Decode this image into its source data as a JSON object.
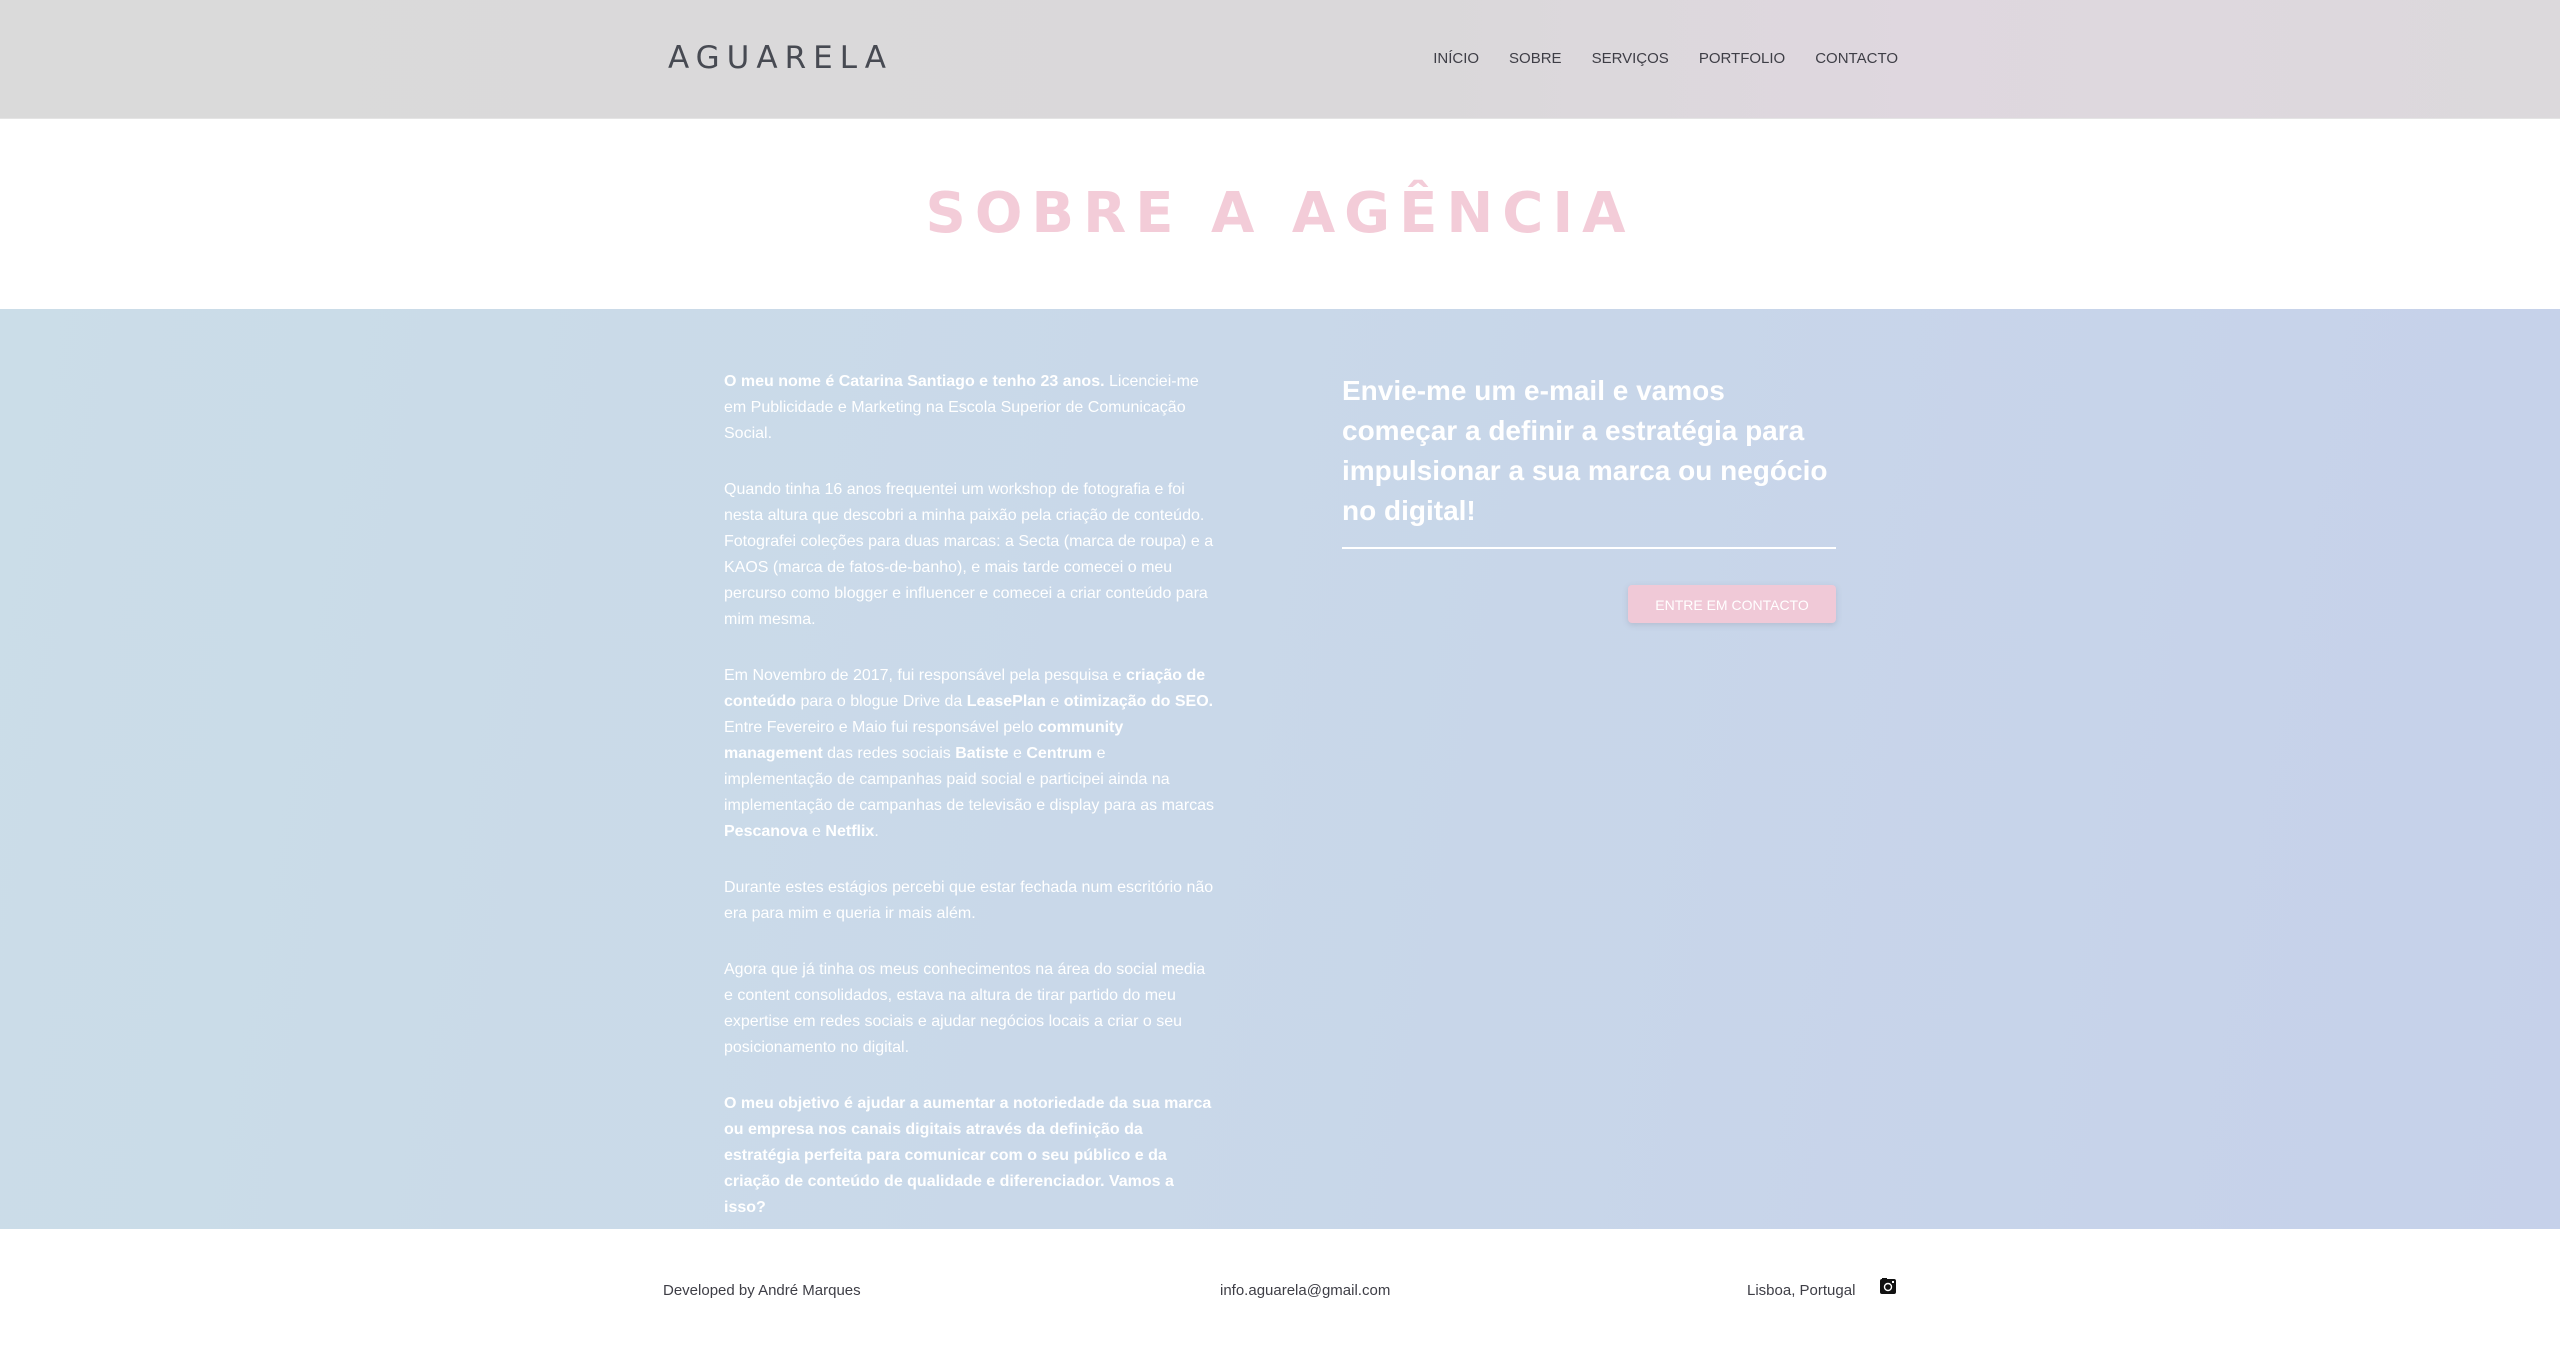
{
  "header": {
    "logo": "AGUARELA",
    "nav": [
      {
        "label": "INÍCIO"
      },
      {
        "label": "SOBRE"
      },
      {
        "label": "SERVIÇOS"
      },
      {
        "label": "PORTFOLIO"
      },
      {
        "label": "CONTACTO"
      }
    ]
  },
  "title": "SOBRE A AGÊNCIA",
  "bio": {
    "p1": [
      {
        "text": "O meu nome é Catarina Santiago e tenho 23 anos.",
        "bold": true
      },
      {
        "text": " Licenciei-me em Publicidade e Marketing na Escola Superior de Comunicação Social.",
        "bold": false
      }
    ],
    "p2": [
      {
        "text": "Quando tinha 16 anos frequentei um workshop de fotografia e foi nesta altura que descobri a minha paixão pela criação de conteúdo. Fotografei coleções para duas marcas: a Secta (marca de roupa) e a KAOS (marca de fatos-de-banho), e mais tarde comecei o meu percurso como blogger e influencer e comecei a criar conteúdo para mim mesma.",
        "bold": false
      }
    ],
    "p3": [
      {
        "text": "Em Novembro de 2017, fui responsável pela pesquisa e ",
        "bold": false
      },
      {
        "text": "criação de conteúdo",
        "bold": true
      },
      {
        "text": " para o blogue Drive da ",
        "bold": false
      },
      {
        "text": "LeasePlan",
        "bold": true
      },
      {
        "text": " e ",
        "bold": false
      },
      {
        "text": "otimização do SEO.",
        "bold": true
      },
      {
        "text": " Entre Fevereiro e Maio fui responsável pelo ",
        "bold": false
      },
      {
        "text": "community management",
        "bold": true
      },
      {
        "text": " das redes sociais ",
        "bold": false
      },
      {
        "text": "Batiste",
        "bold": true
      },
      {
        "text": " e ",
        "bold": false
      },
      {
        "text": "Centrum",
        "bold": true
      },
      {
        "text": " e implementação de campanhas paid social e participei ainda na implementação de campanhas de televisão e display para as marcas ",
        "bold": false
      },
      {
        "text": "Pescanova",
        "bold": true
      },
      {
        "text": " e ",
        "bold": false
      },
      {
        "text": "Netflix",
        "bold": true
      },
      {
        "text": ".",
        "bold": false
      }
    ],
    "p4": [
      {
        "text": "Durante estes estágios percebi que estar fechada num escritório não era para mim e queria ir mais além.",
        "bold": false
      }
    ],
    "p5": [
      {
        "text": "Agora que já tinha os meus conhecimentos na área do social media e content consolidados, estava na altura de tirar partido do meu expertise em redes sociais e ajudar negócios locais a criar o seu posicionamento no digital.",
        "bold": false
      }
    ],
    "p6": [
      {
        "text": "O meu objetivo é ajudar a aumentar a notoriedade da sua marca ou empresa nos canais digitais através da definição da estratégia perfeita para comunicar com o seu público e da criação de conteúdo de qualidade e diferenciador. Vamos a isso?",
        "bold": true
      }
    ]
  },
  "cta": {
    "heading": "Envie-me um e-mail e vamos começar a definir a estratégia para impulsionar a sua marca ou negócio no digital!",
    "button": "ENTRE EM CONTACTO"
  },
  "footer": {
    "developed_by": "Developed by André Marques",
    "email": "info.aguarela@gmail.com",
    "location": "Lisboa, Portugal",
    "social_icon": "instagram-icon"
  },
  "colors": {
    "title_pink": "#f3ccd8",
    "button_pink": "#f0c9d7",
    "main_bg_start": "#cbdde8",
    "main_bg_end": "#c6d1ea",
    "text_dark": "#3e3e46"
  }
}
